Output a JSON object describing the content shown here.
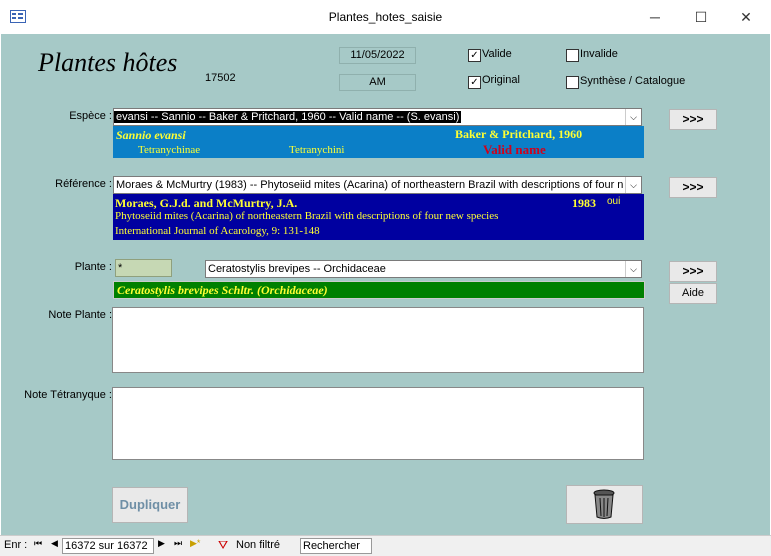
{
  "window": {
    "title": "Plantes_hotes_saisie",
    "minimize": "─",
    "maximize": "☐",
    "close": "✕"
  },
  "form": {
    "title": "Plantes hôtes",
    "record_id": "17502",
    "date": "11/05/2022",
    "session": "AM",
    "checkboxes": {
      "valide": "Valide",
      "invalide": "Invalide",
      "original": "Original",
      "synthese": "Synthèse / Catalogue"
    },
    "espece": {
      "label": "Espèce :",
      "combo_value": "evansi  --   Sannio   --  Baker & Pritchard, 1960   --  Valid name  --  (S. evansi)",
      "name": "Sannio evansi",
      "author": "Baker & Pritchard, 1960",
      "subfamily": "Tetranychinae",
      "tribe": "Tetranychini",
      "status": "Valid name",
      "goto": ">>>"
    },
    "reference": {
      "label": "Référence :",
      "combo_value": "Moraes & McMurtry (1983)  --  Phytoseiid mites (Acarina) of northeastern Brazil with descriptions of four n",
      "authors": "Moraes, G.J.d. and McMurtry, J.A.",
      "year": "1983",
      "oui": "oui",
      "title": "Phytoseiid mites (Acarina) of northeastern Brazil with descriptions of four new species",
      "journal": "International Journal of Acarology, 9: 131-148",
      "goto": ">>>"
    },
    "plante": {
      "label": "Plante :",
      "code": "*",
      "combo_value": "Ceratostylis brevipes  --  Orchidaceae",
      "full_name": "Ceratostylis brevipes Schltr. (Orchidaceae)",
      "goto": ">>>",
      "aide": "Aide"
    },
    "note_plante": {
      "label": "Note Plante :",
      "value": ""
    },
    "note_tetranyque": {
      "label": "Note Tétranyque :",
      "value": ""
    },
    "dupliquer": "Dupliquer"
  },
  "status": {
    "enr_label": "Enr :",
    "nav_first": "⏮",
    "nav_prev": "◀",
    "record_pos": "16372 sur 16372",
    "nav_next": "▶",
    "nav_last": "⏭",
    "nav_new": "▶*",
    "filter": "Non filtré",
    "search": "Rechercher"
  }
}
